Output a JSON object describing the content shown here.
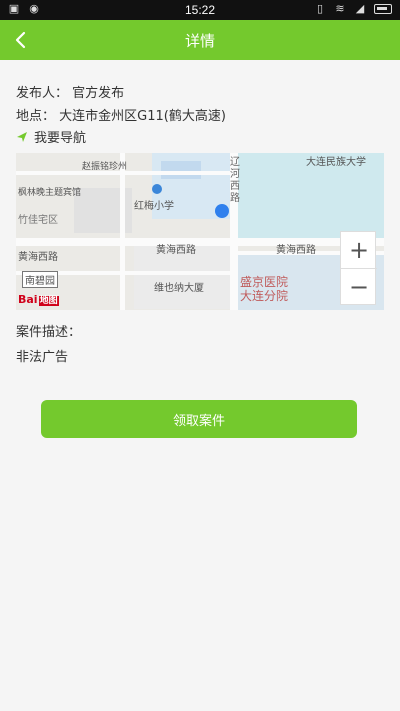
{
  "status_bar": {
    "time": "15:22"
  },
  "header": {
    "title": "详情"
  },
  "details": {
    "publisher_label": "发布人：",
    "publisher_value": "官方发布",
    "location_label": "地点：",
    "location_value": "大连市金州区G11(鹤大高速)",
    "navigate_label": "我要导航"
  },
  "map": {
    "labels": [
      "赵振铭珍州",
      "辽",
      "河",
      "西",
      "路",
      "大连民族大学",
      "枫林晚主题宾馆",
      "红梅小学",
      "竹佳宅区",
      "黄海西路",
      "黄海西路",
      "黄海西路",
      "南碧园",
      "维也纳大厦",
      "盛京医院",
      "大连分院"
    ],
    "logo_text": "Bai",
    "logo_suffix": "地图"
  },
  "case": {
    "label": "案件描述：",
    "description": "非法广告"
  },
  "action": {
    "button_label": "领取案件"
  },
  "colors": {
    "accent": "#74c92d",
    "map_blue_marker": "#2f80ed"
  }
}
